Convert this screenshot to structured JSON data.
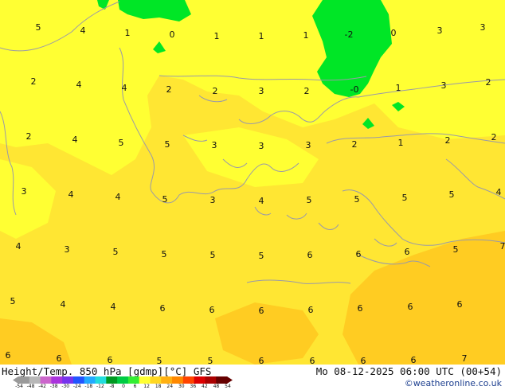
{
  "title": "Height/Temp. 850 hPa [gdmp][°C] GFS",
  "datetime": "Mo 08-12-2025 06:00 UTC (00+54)",
  "credit": "©weatheronline.co.uk",
  "colors": {
    "sea_light": "#ffff33",
    "land_yellow": "#ffe633",
    "warm_orange": "#ffcc22",
    "cold_green": "#00e626",
    "coastline": "#9a9aa8"
  },
  "colorbar": {
    "ticks": [
      "-54",
      "-48",
      "-42",
      "-38",
      "-30",
      "-24",
      "-18",
      "-12",
      "-8",
      "0",
      "6",
      "12",
      "18",
      "24",
      "30",
      "36",
      "42",
      "48",
      "54"
    ],
    "colors": [
      "#9a9a9a",
      "#b8b8b8",
      "#cc66cc",
      "#aa33dd",
      "#7733ee",
      "#2255ff",
      "#22aaff",
      "#22dddd",
      "#009922",
      "#00cc44",
      "#33ee33",
      "#ffff33",
      "#ffd722",
      "#ffb011",
      "#ff8800",
      "#ff4400",
      "#dd0000",
      "#aa0000",
      "#660000"
    ]
  },
  "temperature_labels": [
    {
      "text": "5"
    },
    {
      "text": "4"
    },
    {
      "text": "1"
    },
    {
      "text": "0"
    },
    {
      "text": "1"
    },
    {
      "text": "1"
    },
    {
      "text": "1"
    },
    {
      "text": "-2"
    },
    {
      "text": "0"
    },
    {
      "text": "3"
    },
    {
      "text": "3"
    },
    {
      "text": "2"
    },
    {
      "text": "4"
    },
    {
      "text": "4"
    },
    {
      "text": "2"
    },
    {
      "text": "2"
    },
    {
      "text": "3"
    },
    {
      "text": "2"
    },
    {
      "text": "-0"
    },
    {
      "text": "1"
    },
    {
      "text": "3"
    },
    {
      "text": "2"
    },
    {
      "text": "2"
    },
    {
      "text": "4"
    },
    {
      "text": "5"
    },
    {
      "text": "5"
    },
    {
      "text": "3"
    },
    {
      "text": "3"
    },
    {
      "text": "3"
    },
    {
      "text": "2"
    },
    {
      "text": "1"
    },
    {
      "text": "2"
    },
    {
      "text": "2"
    },
    {
      "text": "3"
    },
    {
      "text": "4"
    },
    {
      "text": "4"
    },
    {
      "text": "5"
    },
    {
      "text": "3"
    },
    {
      "text": "4"
    },
    {
      "text": "5"
    },
    {
      "text": "5"
    },
    {
      "text": "5"
    },
    {
      "text": "5"
    },
    {
      "text": "4"
    },
    {
      "text": "4"
    },
    {
      "text": "3"
    },
    {
      "text": "5"
    },
    {
      "text": "5"
    },
    {
      "text": "5"
    },
    {
      "text": "5"
    },
    {
      "text": "6"
    },
    {
      "text": "6"
    },
    {
      "text": "6"
    },
    {
      "text": "5"
    },
    {
      "text": "7"
    },
    {
      "text": "5"
    },
    {
      "text": "4"
    },
    {
      "text": "4"
    },
    {
      "text": "6"
    },
    {
      "text": "6"
    },
    {
      "text": "6"
    },
    {
      "text": "6"
    },
    {
      "text": "6"
    },
    {
      "text": "6"
    },
    {
      "text": "6"
    },
    {
      "text": "6"
    },
    {
      "text": "6"
    },
    {
      "text": "6"
    },
    {
      "text": "5"
    },
    {
      "text": "5"
    },
    {
      "text": "6"
    },
    {
      "text": "6"
    },
    {
      "text": "6"
    },
    {
      "text": "6"
    },
    {
      "text": "7"
    }
  ]
}
